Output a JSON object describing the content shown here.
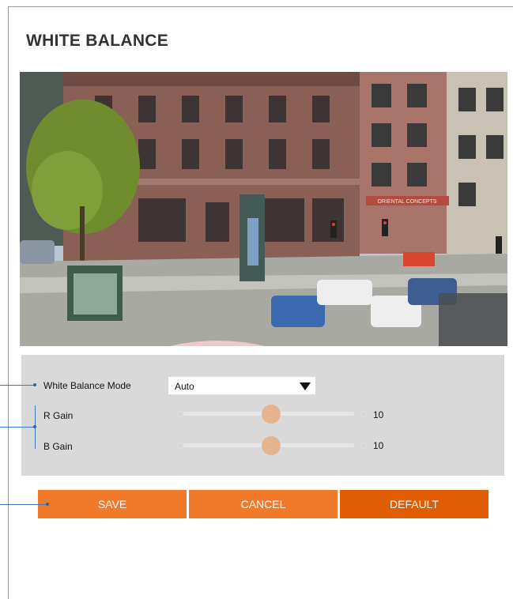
{
  "page": {
    "title": "WHITE BALANCE"
  },
  "preview": {
    "sign_text": "ORIENTAL CONCEPTS"
  },
  "settings": {
    "mode": {
      "label": "White Balance Mode",
      "value": "Auto"
    },
    "r_gain": {
      "label": "R Gain",
      "value": "10",
      "level": 0.5
    },
    "b_gain": {
      "label": "B Gain",
      "value": "10",
      "level": 0.5
    }
  },
  "buttons": {
    "save": "SAVE",
    "cancel": "CANCEL",
    "default": "DEFAULT"
  },
  "colors": {
    "button": "#f07a2a",
    "button_default": "#e15d05",
    "slider_thumb": "#e6b38f",
    "panel": "#d9d9d9",
    "callout": "#3a7bbf"
  }
}
